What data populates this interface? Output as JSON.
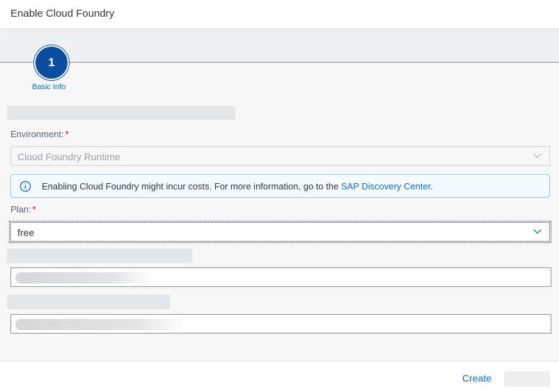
{
  "dialog": {
    "title": "Enable Cloud Foundry"
  },
  "wizard": {
    "steps": [
      {
        "number": "1",
        "label": "Basic Info"
      }
    ]
  },
  "form": {
    "environment": {
      "label": "Environment:",
      "required_mark": "*",
      "value": "Cloud Foundry Runtime"
    },
    "info": {
      "text": "Enabling Cloud Foundry might incur costs. For more information, go to the ",
      "link_text": "SAP Discovery Center",
      "suffix": "."
    },
    "plan": {
      "label": "Plan:",
      "required_mark": "*",
      "value": "free"
    }
  },
  "footer": {
    "create_label": "Create"
  },
  "colors": {
    "accent": "#0a6ed1",
    "step_active": "#0a4f9f",
    "required": "#bb0000",
    "info_border": "#91c8f6"
  }
}
